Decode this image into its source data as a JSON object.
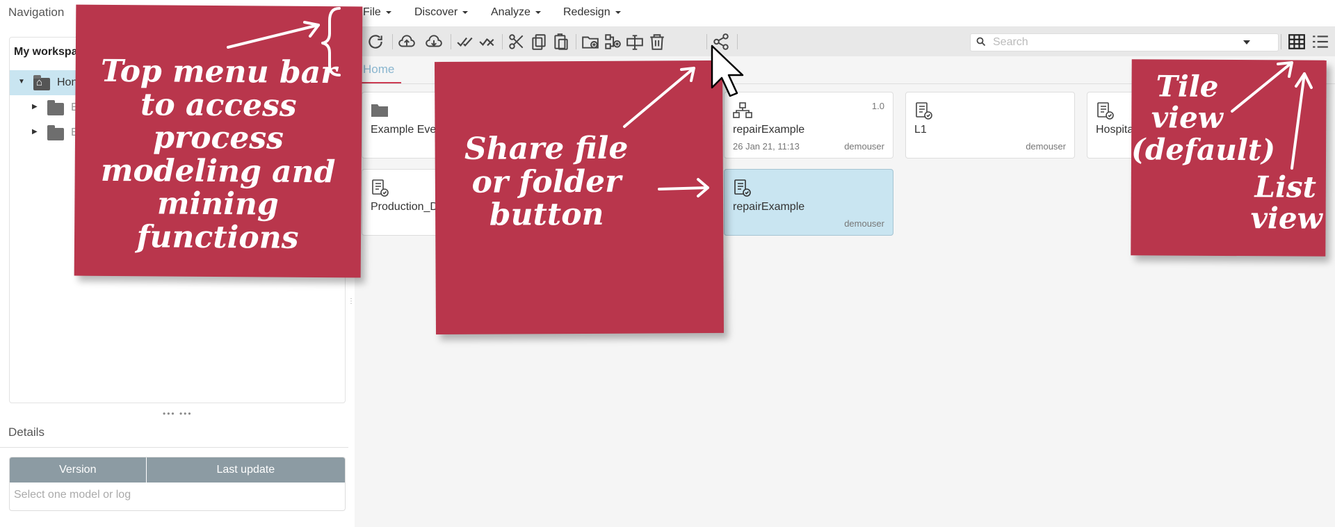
{
  "navigation": {
    "title": "Navigation",
    "workspace_title": "My workspa",
    "tree": [
      {
        "label": "Hon",
        "selected": true,
        "icon": "home-folder-icon"
      },
      {
        "label": "E",
        "selected": false,
        "icon": "folder-icon"
      },
      {
        "label": "E",
        "selected": false,
        "icon": "folder-icon"
      }
    ]
  },
  "details": {
    "title": "Details",
    "columns": [
      "Version",
      "Last update"
    ],
    "empty_text": "Select one model or log"
  },
  "menubar": {
    "items": [
      "File",
      "Discover",
      "Analyze",
      "Redesign"
    ]
  },
  "toolbar": {
    "icons": [
      "refresh-icon",
      "upload-icon",
      "download-icon",
      "select-all-icon",
      "deselect-all-icon",
      "cut-icon",
      "copy-icon",
      "paste-icon",
      "new-folder-icon",
      "new-process-icon",
      "rename-icon",
      "delete-icon",
      "share-icon"
    ]
  },
  "search": {
    "placeholder": "Search"
  },
  "views": {
    "tile_icon": "tile-view-icon",
    "list_icon": "list-view-icon"
  },
  "tabs": {
    "home": "Home"
  },
  "tiles": [
    {
      "name": "Example Even",
      "date": "",
      "user": "",
      "version": "",
      "icon": "folder-icon",
      "selected": false
    },
    {
      "name": "repairExample",
      "date": "26 Jan 21, 11:13",
      "user": "demouser",
      "version": "1.0",
      "icon": "process-model-icon",
      "selected": false
    },
    {
      "name": "L1",
      "date": "",
      "user": "demouser",
      "version": "",
      "icon": "log-icon",
      "selected": false
    },
    {
      "name": "Hospita",
      "date": "",
      "user": "",
      "version": "",
      "icon": "log-icon",
      "selected": false
    },
    {
      "name": "Production_D",
      "date": "",
      "user": "",
      "version": "",
      "icon": "log-icon",
      "selected": false
    },
    {
      "name": "repairExample",
      "date": "",
      "user": "demouser",
      "version": "",
      "icon": "log-icon",
      "selected": true
    }
  ],
  "notes": {
    "menu_note": "Top menu bar to access process modeling and mining functions",
    "share_note": "Share file or folder button",
    "tile_note": "Tile view (default)",
    "list_note": "List view"
  },
  "colors": {
    "note_red": "#b9364c",
    "selection_blue": "#c9e5f1",
    "tab_accent": "#cc3b52",
    "table_header": "#8c9ba3"
  }
}
